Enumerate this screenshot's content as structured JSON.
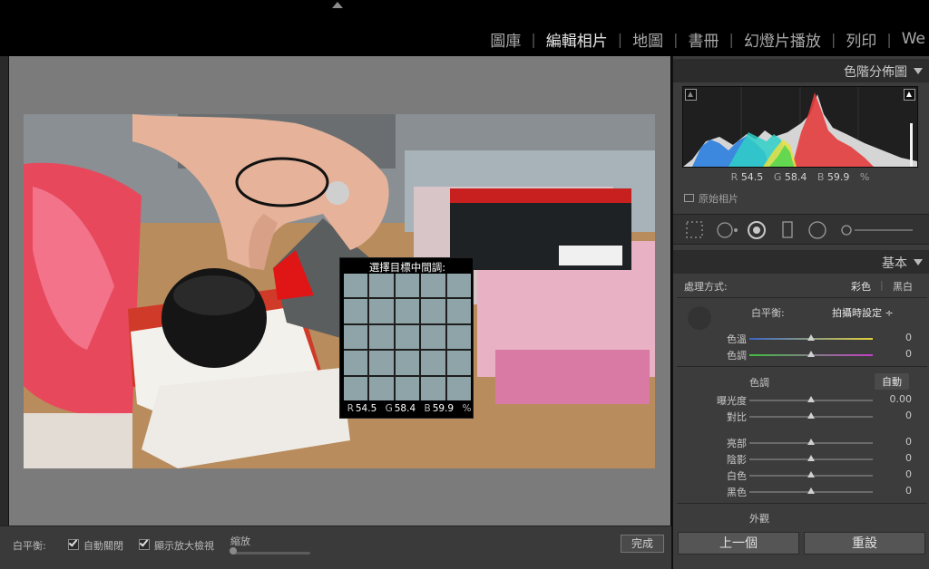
{
  "modules": [
    "圖庫",
    "編輯相片",
    "地圖",
    "書冊",
    "幻燈片播放",
    "列印",
    "We"
  ],
  "active_module": "編輯相片",
  "loupe": {
    "title": "選擇目標中間調:",
    "r_label": "R",
    "r_value": "54.5",
    "g_label": "G",
    "g_value": "58.4",
    "b_label": "B",
    "b_value": "59.9",
    "unit": "%"
  },
  "toolbar": {
    "wb_label": "白平衡:",
    "auto_dismiss_label": "自動關閉",
    "show_loupe_label": "顯示放大檢視",
    "zoom_label": "縮放",
    "done_label": "完成"
  },
  "histogram_panel": {
    "title": "色階分佈圖",
    "r_label": "R",
    "r_value": "54.5",
    "g_label": "G",
    "g_value": "58.4",
    "b_label": "B",
    "b_value": "59.9",
    "unit": "%",
    "original_label": "原始相片"
  },
  "basic_panel": {
    "title": "基本",
    "treatment_label": "處理方式:",
    "treatment_color": "彩色",
    "treatment_bw": "黑白",
    "wb_label": "白平衡:",
    "wb_value": "拍攝時設定 ÷",
    "tone_label": "色調",
    "auto_label": "自動",
    "presence_label": "外觀",
    "sliders": [
      {
        "label": "色溫",
        "value": "0",
        "pos": 0.5,
        "kind": "temp"
      },
      {
        "label": "色調",
        "value": "0",
        "pos": 0.5,
        "kind": "tint"
      },
      {
        "label": "曝光度",
        "value": "0.00",
        "pos": 0.5,
        "kind": "plain"
      },
      {
        "label": "對比",
        "value": "0",
        "pos": 0.5,
        "kind": "plain"
      },
      {
        "label": "亮部",
        "value": "0",
        "pos": 0.5,
        "kind": "plain"
      },
      {
        "label": "陰影",
        "value": "0",
        "pos": 0.5,
        "kind": "plain"
      },
      {
        "label": "白色",
        "value": "0",
        "pos": 0.5,
        "kind": "plain"
      },
      {
        "label": "黑色",
        "value": "0",
        "pos": 0.5,
        "kind": "plain"
      }
    ]
  },
  "buttons": {
    "previous": "上一個",
    "reset": "重設"
  }
}
